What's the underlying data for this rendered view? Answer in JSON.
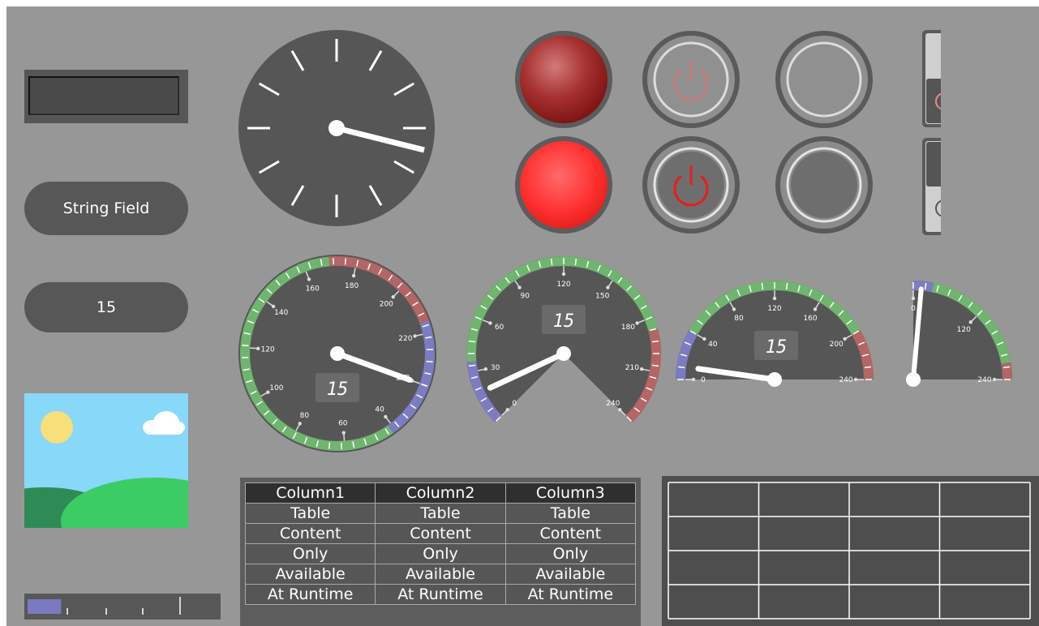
{
  "lcd_display": {
    "value": ""
  },
  "string_field": {
    "label": "String Field"
  },
  "number_field": {
    "value": "15"
  },
  "clock": {
    "hour_hand": "hour",
    "minute_hand": "minute"
  },
  "led_indicators": [
    {
      "state": "off",
      "color": "#c33434"
    },
    {
      "state": "on",
      "color": "#ff2f2f"
    }
  ],
  "power_buttons": [
    {
      "state": "off",
      "icon": "power-icon",
      "color": "#c57b7b"
    },
    {
      "state": "on",
      "icon": "power-icon",
      "color": "#e81c1c"
    }
  ],
  "round_buttons": [
    {
      "state": "released"
    },
    {
      "state": "pressed"
    }
  ],
  "toggle_switches": [
    {
      "on_symbol": "|",
      "off_symbol": "O",
      "active": "off"
    },
    {
      "on_symbol": "|",
      "off_symbol": "O",
      "active": "on"
    }
  ],
  "colors": {
    "gauge_green": "#6fb56f",
    "gauge_red": "#b46565",
    "gauge_blue": "#7c7cc2",
    "panel_bg": "#979797",
    "widget_dark": "#575757"
  },
  "gauges": [
    {
      "name": "full-gauge",
      "value": "15",
      "inner_ticks": [
        "20",
        "40",
        "60",
        "80",
        "100",
        "120",
        "140",
        "160",
        "180",
        "200",
        "220",
        "240"
      ]
    },
    {
      "name": "three-quarter-gauge",
      "value": "15",
      "ticks": [
        "0",
        "30",
        "60",
        "90",
        "120",
        "150",
        "180",
        "210",
        "240"
      ]
    },
    {
      "name": "half-gauge",
      "value": "15",
      "ticks": [
        "0",
        "40",
        "80",
        "120",
        "160",
        "200",
        "240"
      ]
    },
    {
      "name": "quarter-gauge",
      "ticks": [
        "0",
        "120",
        "240"
      ]
    }
  ],
  "slider": {
    "value_fraction": 0.18
  },
  "table": {
    "columns": [
      "Column1",
      "Column2",
      "Column3"
    ],
    "rows": [
      [
        "Table",
        "Table",
        "Table"
      ],
      [
        "Content",
        "Content",
        "Content"
      ],
      [
        "Only",
        "Only",
        "Only"
      ],
      [
        "Available",
        "Available",
        "Available"
      ],
      [
        "At Runtime",
        "At Runtime",
        "At Runtime"
      ]
    ]
  },
  "grid": {
    "rows": 4,
    "cols": 4
  }
}
